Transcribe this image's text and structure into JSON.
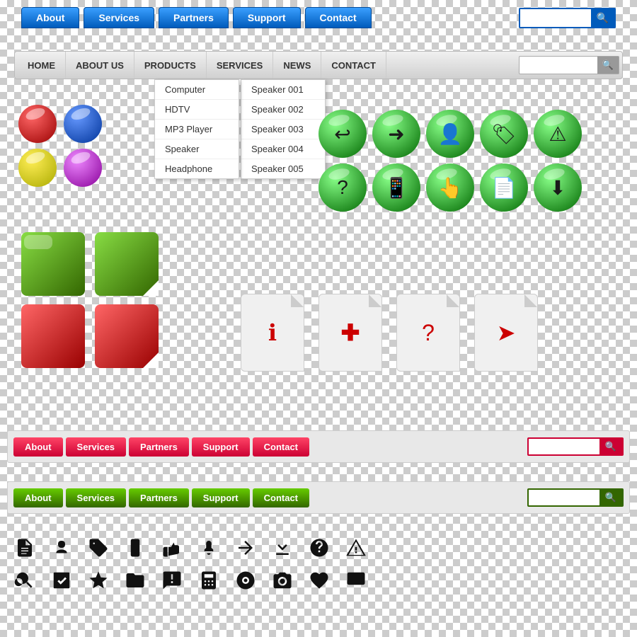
{
  "blue_nav": {
    "tabs": [
      "About",
      "Services",
      "Partners",
      "Support",
      "Contact"
    ],
    "search_placeholder": ""
  },
  "gray_nav": {
    "tabs": [
      "HOME",
      "ABOUT US",
      "PRODUCTS",
      "SERVICES",
      "NEWS",
      "CONTACT"
    ],
    "search_placeholder": ""
  },
  "dropdown": {
    "items": [
      "Computer",
      "HDTV",
      "MP3 Player",
      "Speaker",
      "Headphone"
    ],
    "sub_items": [
      "Speaker 001",
      "Speaker 002",
      "Speaker 003",
      "Speaker 004",
      "Speaker 005"
    ]
  },
  "red_nav": {
    "tabs": [
      "About",
      "Services",
      "Partners",
      "Support",
      "Contact"
    ],
    "search_placeholder": ""
  },
  "green_nav": {
    "tabs": [
      "About",
      "Services",
      "Partners",
      "Support",
      "Contact"
    ],
    "search_placeholder": ""
  },
  "paper_icons": [
    "ℹ",
    "+",
    "?",
    "▶"
  ],
  "green_ball_icons_row1": [
    "↩",
    "→",
    "👤",
    "🏷",
    "⚠"
  ],
  "green_ball_icons_row2": [
    "?",
    "📱",
    "👆",
    "📄",
    "⬇"
  ]
}
